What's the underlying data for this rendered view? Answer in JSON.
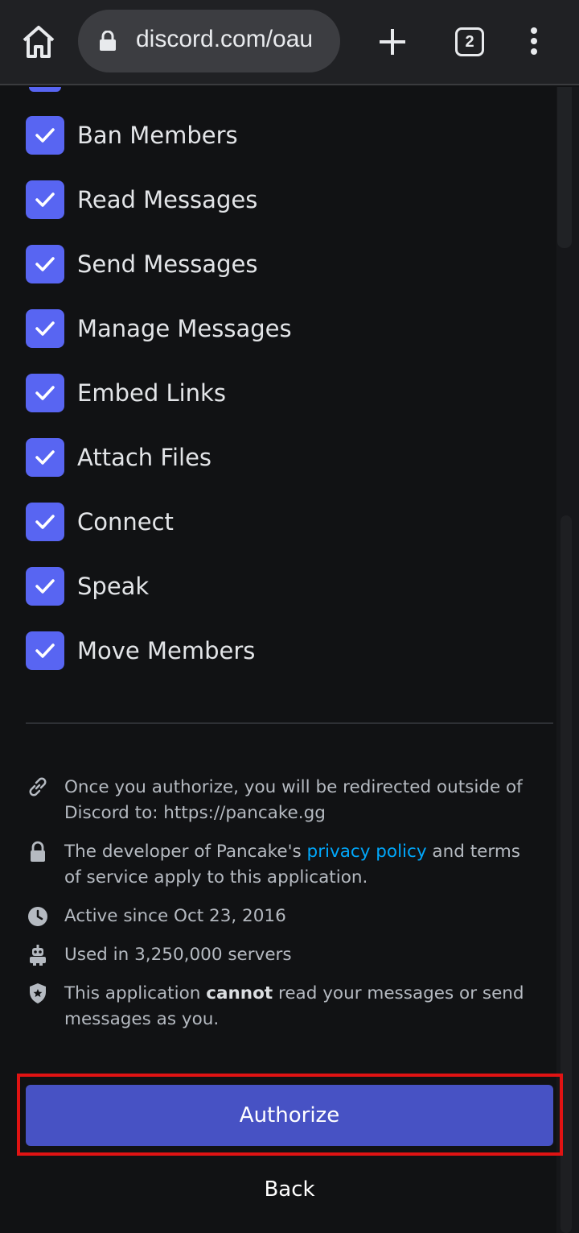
{
  "browser": {
    "url": "discord.com/oau",
    "tab_count": "2"
  },
  "permissions": [
    {
      "label": "Ban Members",
      "checked": true
    },
    {
      "label": "Read Messages",
      "checked": true
    },
    {
      "label": "Send Messages",
      "checked": true
    },
    {
      "label": "Manage Messages",
      "checked": true
    },
    {
      "label": "Embed Links",
      "checked": true
    },
    {
      "label": "Attach Files",
      "checked": true
    },
    {
      "label": "Connect",
      "checked": true
    },
    {
      "label": "Speak",
      "checked": true
    },
    {
      "label": "Move Members",
      "checked": true
    }
  ],
  "info": {
    "redirect": "Once you authorize, you will be redirected outside of Discord to: https://pancake.gg",
    "privacy_pre": "The developer of Pancake's ",
    "privacy_link": "privacy policy",
    "privacy_post": " and terms of service apply to this application.",
    "active_since": "Active since Oct 23, 2016",
    "servers": "Used in 3,250,000 servers",
    "cannot_pre": "This application ",
    "cannot_bold": "cannot",
    "cannot_post": " read your messages or send messages as you."
  },
  "actions": {
    "authorize_label": "Authorize",
    "back_label": "Back"
  },
  "colors": {
    "accent": "#5865f2",
    "button": "#4752c4",
    "link": "#00a8fc",
    "highlight": "#e01313",
    "background": "#111214"
  }
}
